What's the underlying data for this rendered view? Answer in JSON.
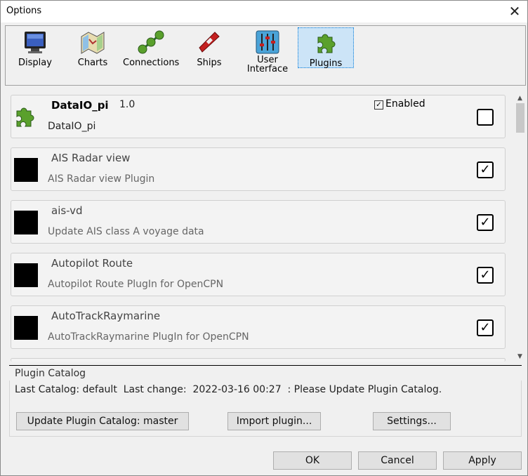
{
  "window": {
    "title": "Options",
    "close_symbol": "✕"
  },
  "toolbar": {
    "items": [
      {
        "label": "Display",
        "icon": "display-icon"
      },
      {
        "label": "Charts",
        "icon": "charts-icon"
      },
      {
        "label": "Connections",
        "icon": "connections-icon"
      },
      {
        "label": "Ships",
        "icon": "ships-icon"
      },
      {
        "label_line1": "User",
        "label_line2": "Interface",
        "icon": "user-interface-icon"
      },
      {
        "label": "Plugins",
        "icon": "plugins-icon",
        "active": true
      }
    ]
  },
  "plugins": [
    {
      "name": "DataIO_pi",
      "version": "1.0",
      "description": "DataIO_pi",
      "enabled_label": "Enabled",
      "enabled_checked_mark": "✓",
      "checked": false,
      "selected": true
    },
    {
      "name": "AIS Radar view",
      "description": "AIS Radar view Plugin",
      "checked": true
    },
    {
      "name": "ais-vd",
      "description": "Update AIS class A voyage data",
      "checked": true
    },
    {
      "name": "Autopilot Route",
      "description": "Autopilot Route PlugIn for OpenCPN",
      "checked": true
    },
    {
      "name": "AutoTrackRaymarine",
      "description": "AutoTrackRaymarine PlugIn for OpenCPN",
      "checked": true
    }
  ],
  "check_mark": "✓",
  "catalog": {
    "title": "Plugin Catalog",
    "status": "Last Catalog: default  Last change:  2022-03-16 00:27  : Please Update Plugin Catalog.",
    "update_button": "Update Plugin Catalog: master",
    "import_button": "Import plugin...",
    "settings_button": "Settings..."
  },
  "footer": {
    "ok": "OK",
    "cancel": "Cancel",
    "apply": "Apply"
  },
  "colors": {
    "selected_tool_bg": "#cce4f7",
    "plugin_green": "#5aa02c"
  }
}
